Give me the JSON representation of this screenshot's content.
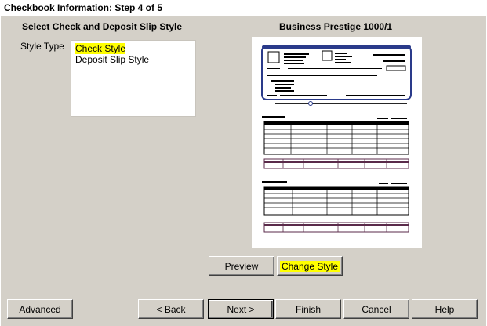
{
  "window": {
    "title": "Checkbook Information: Step 4 of 5"
  },
  "left_section": {
    "title": "Select Check and Deposit Slip Style",
    "style_type_label": "Style Type",
    "style_options": [
      {
        "label": "Check Style",
        "selected": true
      },
      {
        "label": "Deposit Slip Style",
        "selected": false
      }
    ]
  },
  "right_section": {
    "title": "Business Prestige 1000/1"
  },
  "buttons": {
    "preview": "Preview",
    "change_style": "Change Style",
    "advanced": "Advanced",
    "back": "< Back",
    "next": "Next >",
    "finish": "Finish",
    "cancel": "Cancel",
    "help": "Help"
  },
  "colors": {
    "highlight": "#ffff00",
    "check_border": "#2a3a8a",
    "slip_band": "#5a2a4a"
  }
}
